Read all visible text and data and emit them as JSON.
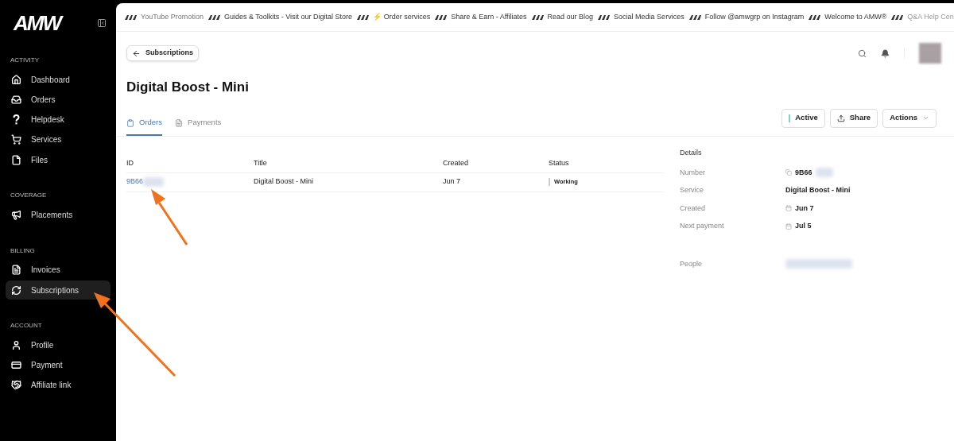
{
  "logo": "AMW",
  "ticker": [
    "YouTube Promotion",
    "Guides & Toolkits - Visit our Digital Store",
    "⚡ Order services",
    "Share & Earn - Affiliates",
    "Read our Blog",
    "Social Media Services",
    "Follow @amwgrp on Instagram",
    "Welcome to AMW®",
    "Q&A Help Cen"
  ],
  "sidebar": [
    {
      "heading": "ACTIVITY",
      "items": [
        {
          "label": "Dashboard",
          "selected": false
        },
        {
          "label": "Orders",
          "selected": false
        },
        {
          "label": "Helpdesk",
          "selected": false
        },
        {
          "label": "Services",
          "selected": false
        },
        {
          "label": "Files",
          "selected": false
        }
      ]
    },
    {
      "heading": "COVERAGE",
      "items": [
        {
          "label": "Placements",
          "selected": false
        }
      ]
    },
    {
      "heading": "BILLING",
      "items": [
        {
          "label": "Invoices",
          "selected": false
        },
        {
          "label": "Subscriptions",
          "selected": true
        }
      ]
    },
    {
      "heading": "ACCOUNT",
      "items": [
        {
          "label": "Profile",
          "selected": false
        },
        {
          "label": "Payment",
          "selected": false
        },
        {
          "label": "Affiliate link",
          "selected": false
        }
      ]
    }
  ],
  "back_button": "Subscriptions",
  "page_title": "Digital Boost - Mini",
  "tabs": [
    {
      "label": "Orders",
      "selected": true
    },
    {
      "label": "Payments",
      "selected": false
    }
  ],
  "actions": {
    "status": "Active",
    "share": "Share",
    "menu": "Actions"
  },
  "table": {
    "columns": [
      "ID",
      "Title",
      "Created",
      "Status"
    ],
    "rows": [
      {
        "id": "9B66",
        "title": "Digital Boost - Mini",
        "created": "Jun 7",
        "status": "Working"
      }
    ]
  },
  "details": {
    "heading": "Details",
    "fields": [
      {
        "label": "Number",
        "value": "9B66",
        "kind": "number"
      },
      {
        "label": "Service",
        "value": "Digital Boost - Mini",
        "kind": "text"
      },
      {
        "label": "Created",
        "value": "Jun 7",
        "kind": "date"
      },
      {
        "label": "Next payment",
        "value": "Jul 5",
        "kind": "date"
      },
      {
        "label": "People",
        "kind": "person"
      }
    ]
  }
}
